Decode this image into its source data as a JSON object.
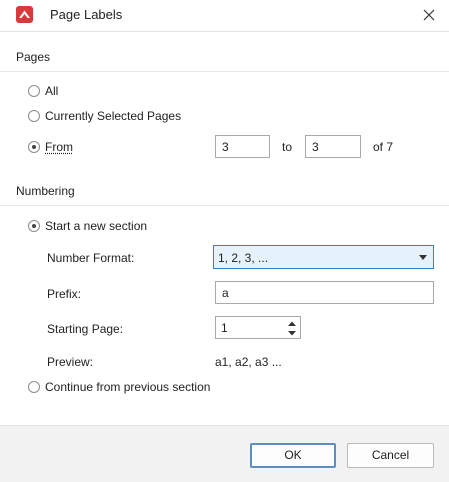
{
  "window": {
    "title": "Page Labels",
    "accent_color": "#d63a3a"
  },
  "pages_section": {
    "title": "Pages",
    "options": {
      "all": "All",
      "selected": "Currently Selected Pages",
      "from": "From"
    },
    "selected_option": "from",
    "from_value": "3",
    "to_label": "to",
    "to_value": "3",
    "of_label": "of 7"
  },
  "numbering_section": {
    "title": "Numbering",
    "start_new_label": "Start a new section",
    "selected_option": "start_new",
    "number_format_label": "Number Format:",
    "number_format_value": "1, 2, 3, ...",
    "prefix_label": "Prefix:",
    "prefix_value": "a",
    "starting_page_label": "Starting Page:",
    "starting_page_value": "1",
    "preview_label": "Preview:",
    "preview_value": "a1, a2, a3 ...",
    "continue_label": "Continue from previous section"
  },
  "footer": {
    "ok_label": "OK",
    "cancel_label": "Cancel"
  }
}
